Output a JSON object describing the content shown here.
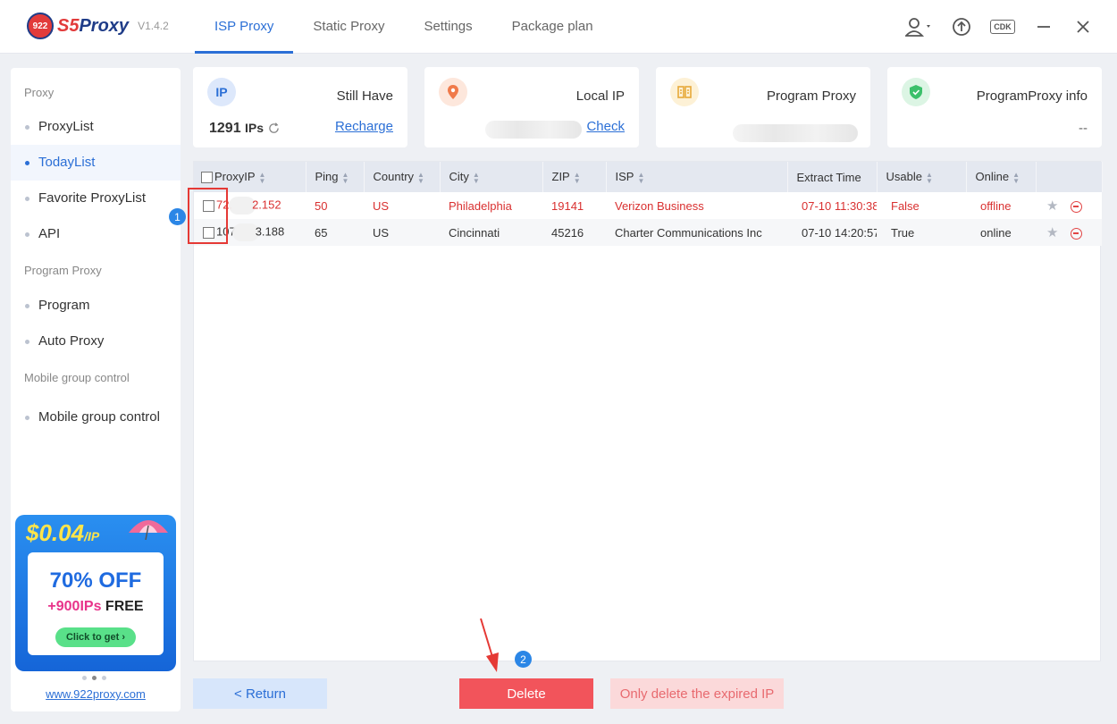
{
  "app": {
    "logo_badge": "922",
    "logo_s5": "S5",
    "logo_proxy": "Proxy",
    "version": "V1.4.2"
  },
  "nav": {
    "tabs": [
      "ISP Proxy",
      "Static Proxy",
      "Settings",
      "Package plan"
    ]
  },
  "header_icons": {
    "user": "user-icon",
    "upload": "upload-icon",
    "cdk": "CDK",
    "minimize": "minimize-icon",
    "close": "close-icon"
  },
  "sidebar": {
    "sections": [
      {
        "title": "Proxy",
        "items": [
          "ProxyList",
          "TodayList",
          "Favorite ProxyList",
          "API"
        ]
      },
      {
        "title": "Program Proxy",
        "items": [
          "Program",
          "Auto Proxy"
        ]
      },
      {
        "title": "Mobile group control",
        "items": [
          "Mobile group control"
        ]
      }
    ],
    "active_item": "TodayList",
    "promo": {
      "price": "$0.04",
      "per": "/IP",
      "off": "70% OFF",
      "plus": "+",
      "ips": "900IPs",
      "free": "FREE",
      "cta": "Click to get ›"
    },
    "link": "www.922proxy.com"
  },
  "cards": {
    "ip": {
      "icon": "IP",
      "title": "Still Have",
      "value": "1291",
      "unit": "IPs",
      "link": "Recharge"
    },
    "local": {
      "icon": "location-pin-icon",
      "title": "Local IP",
      "link": "Check"
    },
    "program": {
      "icon": "program-icon",
      "title": "Program Proxy"
    },
    "info": {
      "icon": "shield-check-icon",
      "title": "ProgramProxy info",
      "value": "--"
    }
  },
  "table": {
    "headers": [
      "ProxyIP",
      "Ping",
      "Country",
      "City",
      "ZIP",
      "ISP",
      "Extract Time",
      "Usable",
      "Online"
    ],
    "rows": [
      {
        "ip_start": "72.",
        "ip_end": "2.152",
        "ping": "50",
        "country": "US",
        "city": "Philadelphia",
        "zip": "19141",
        "isp": "Verizon Business",
        "time": "07-10 11:30:38",
        "usable": "False",
        "online": "offline",
        "status": "red"
      },
      {
        "ip_start": "107",
        "ip_end": "3.188",
        "ping": "65",
        "country": "US",
        "city": "Cincinnati",
        "zip": "45216",
        "isp": "Charter Communications Inc",
        "time": "07-10 14:20:57",
        "usable": "True",
        "online": "online",
        "status": "normal"
      }
    ]
  },
  "annotations": {
    "step1": "1",
    "step2": "2"
  },
  "buttons": {
    "return": "< Return",
    "delete": "Delete",
    "delete_expired": "Only delete the expired IP"
  }
}
